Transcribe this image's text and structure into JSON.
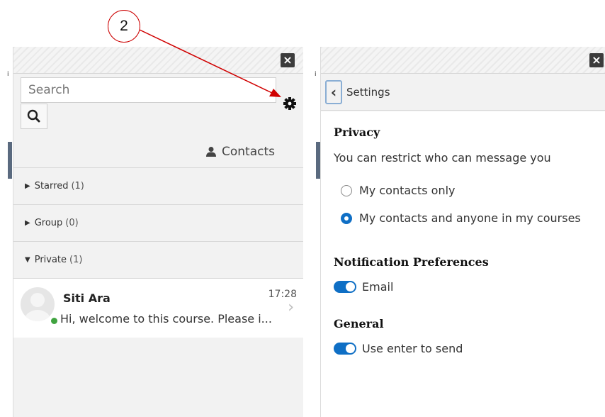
{
  "annotation": {
    "label": "2"
  },
  "left_panel": {
    "search": {
      "placeholder": "Search"
    },
    "contacts_label": "Contacts",
    "sections": [
      {
        "label": "Starred",
        "count": "(1)",
        "state": "collapsed"
      },
      {
        "label": "Group",
        "count": "(0)",
        "state": "collapsed"
      },
      {
        "label": "Private",
        "count": "(1)",
        "state": "expanded"
      }
    ],
    "conversation": {
      "name": "Siti Ara",
      "time": "17:28",
      "preview": "Hi, welcome to this course. Please i...",
      "online": true
    }
  },
  "right_panel": {
    "title": "Settings",
    "privacy": {
      "heading": "Privacy",
      "description": "You can restrict who can message you",
      "options": [
        {
          "label": "My contacts only",
          "selected": false
        },
        {
          "label": "My contacts and anyone in my courses",
          "selected": true
        }
      ]
    },
    "notifications": {
      "heading": "Notification Preferences",
      "email_label": "Email",
      "email_enabled": true
    },
    "general": {
      "heading": "General",
      "enter_label": "Use enter to send",
      "enter_enabled": true
    }
  },
  "colors": {
    "accent": "#0f6fc5",
    "annotation": "#d00000",
    "online": "#3fa33f"
  },
  "icons": [
    "close-icon",
    "search-icon",
    "gear-icon",
    "user-icon",
    "caret-right-icon",
    "caret-down-icon",
    "chevron-right-icon",
    "chevron-left-icon"
  ]
}
